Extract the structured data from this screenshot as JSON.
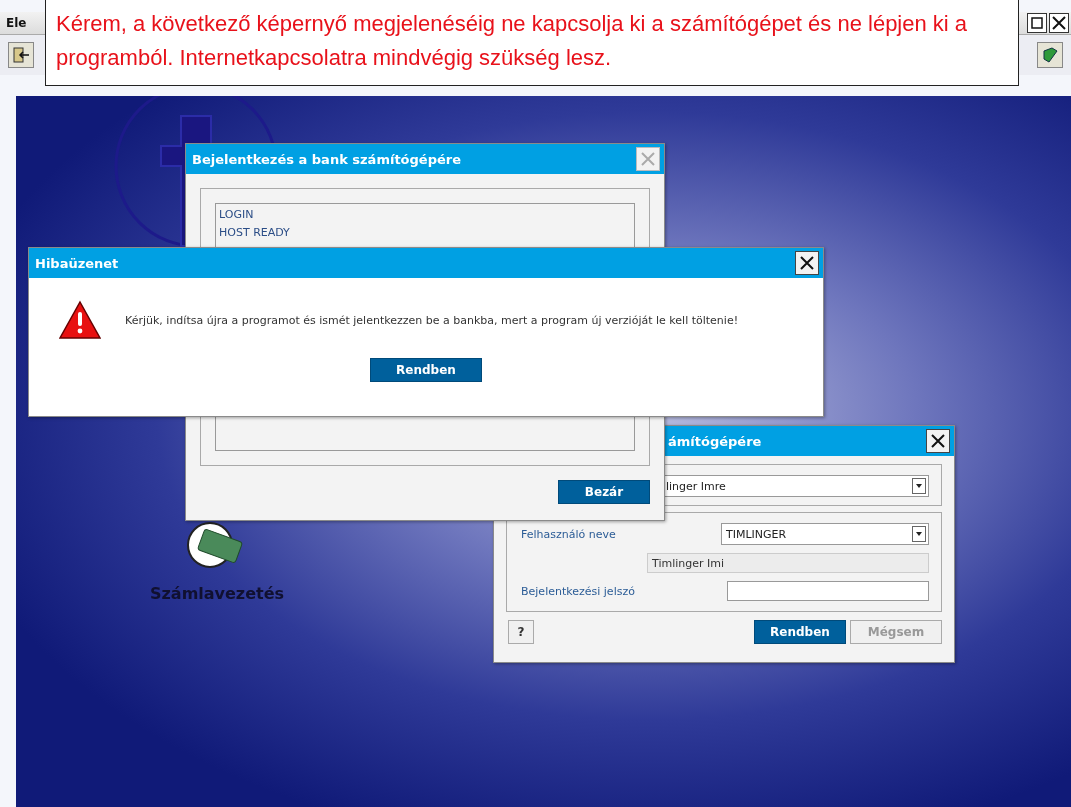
{
  "app_window": {
    "title": "Ele"
  },
  "callout": {
    "text": "Kérem, a következő képernyő megjelenéséig ne kapcsolja ki a számítógépet és ne lépjen ki a programból. Internetkapcsolatra mindvégig szükség lesz."
  },
  "desktop_icons": [
    {
      "label": "Számlavezetés"
    }
  ],
  "log_window": {
    "title": "Bejelentkezés a bank számítógépére",
    "close_disabled": true,
    "log_lines": [
      "LOGIN",
      "HOST READY"
    ],
    "button": "Bezár"
  },
  "error_dialog": {
    "title": "Hibaüzenet",
    "message": "Kérjük, indítsa újra a programot és ismét jelentkezzen be a bankba, mert a program új verzióját le kell töltenie!",
    "button": "Rendben"
  },
  "login_dialog": {
    "title": "ámítógépére",
    "account": "linger Imre",
    "fields": [
      {
        "kind": "select",
        "label": "Felhasználó neve",
        "value": "TIMLINGER"
      },
      {
        "kind": "readonly",
        "value": "Timlinger Imi"
      },
      {
        "kind": "password",
        "label": "Bejelentkezési jelszó"
      }
    ],
    "buttons": [
      {
        "kind": "help",
        "label": "?",
        "disabled": false
      },
      {
        "kind": "primary",
        "label": "Rendben",
        "disabled": false
      },
      {
        "kind": "secondary",
        "label": "Mégsem",
        "disabled": true
      }
    ]
  }
}
